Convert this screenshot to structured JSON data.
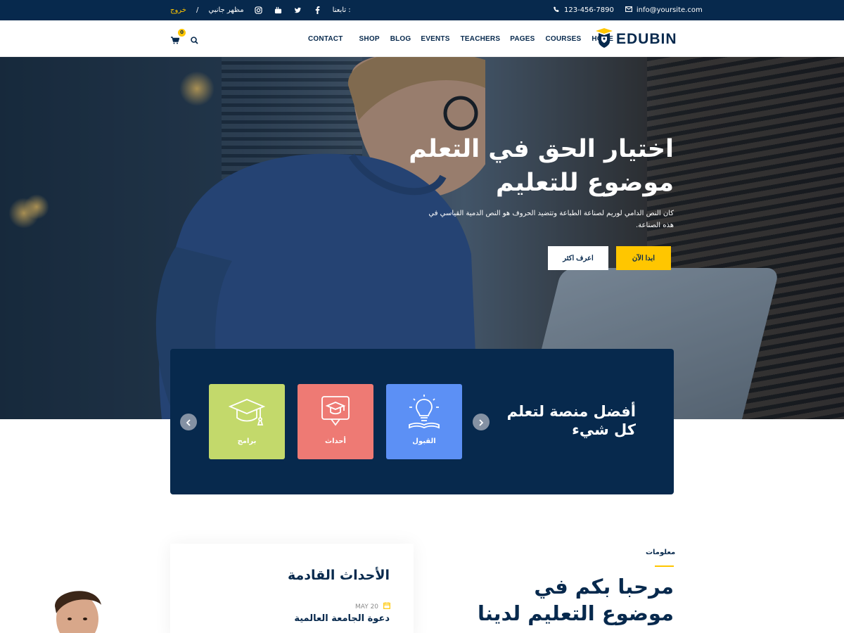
{
  "topbar": {
    "email": "info@yoursite.com",
    "phone": "123-456-7890",
    "follow_label": "تابعنا :",
    "theme_label": "مظهر جانبي",
    "separator": "/",
    "logout_label": "خروج",
    "social_icons": [
      "facebook-icon",
      "twitter-icon",
      "youtube-icon",
      "instagram-icon"
    ]
  },
  "header": {
    "logo_text": "EDUBIN",
    "cart_count": "0",
    "nav": [
      "CONTACT",
      "SHOP",
      "BLOG",
      "EVENTS",
      "TEACHERS",
      "PAGES",
      "COURSES",
      "HOME"
    ]
  },
  "hero": {
    "title_line1": "اختيار الحق في التعلم",
    "title_line2": "موضوع للتعليم",
    "description": "كان النص الدامي لوريم لصناعة الطباعة وتتضيد الحروف هو النص الدمية القياسي في هذه الصناعة.",
    "btn_start": "ابدا الآن",
    "btn_more": "اعرف اكثر"
  },
  "panel": {
    "title": "أفضل منصة لتعلم كل شيء",
    "cards": [
      {
        "label": "القبول",
        "color": "#5c90f5",
        "icon": "lightbulb-book-icon"
      },
      {
        "label": "أحداث",
        "color": "#ee7a74",
        "icon": "board-cap-icon"
      },
      {
        "label": "برامج",
        "color": "#c3d96b",
        "icon": "graduation-cap-icon"
      }
    ]
  },
  "events": {
    "title": "الأحداث القادمة",
    "items": [
      {
        "date": "MAY 20",
        "name": "دعوة الجامعة العالمية"
      }
    ]
  },
  "about": {
    "tag": "معلومات",
    "title": "مرحبا بكم في موضوع التعليم لدينا"
  },
  "colors": {
    "navy": "#07294d",
    "yellow": "#ffc600"
  }
}
